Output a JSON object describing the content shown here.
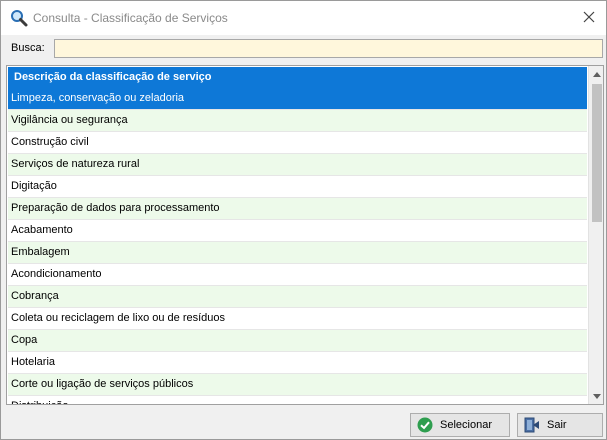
{
  "window": {
    "title": "Consulta - Classificação de Serviços"
  },
  "search": {
    "label": "Busca:",
    "value": "",
    "placeholder": ""
  },
  "grid": {
    "header": "Descrição da classificação de serviço",
    "selected_index": 0,
    "rows": [
      "Limpeza, conservação ou zeladoria",
      "Vigilância ou segurança",
      "Construção civil",
      "Serviços de natureza rural",
      "Digitação",
      "Preparação de dados para processamento",
      "Acabamento",
      "Embalagem",
      "Acondicionamento",
      "Cobrança",
      "Coleta ou reciclagem de lixo ou de resíduos",
      "Copa",
      "Hotelaria",
      "Corte ou ligação de serviços públicos",
      "Distribuição"
    ]
  },
  "buttons": {
    "select_label": "Selecionar",
    "exit_label": "Sair"
  },
  "colors": {
    "selection": "#0e78d7",
    "row_alt": "#edfaea",
    "search_bg": "#fff7dc"
  },
  "icons": {
    "app": "magnifier-icon",
    "close": "close-icon",
    "select": "check-circle-icon",
    "exit": "exit-door-icon"
  }
}
